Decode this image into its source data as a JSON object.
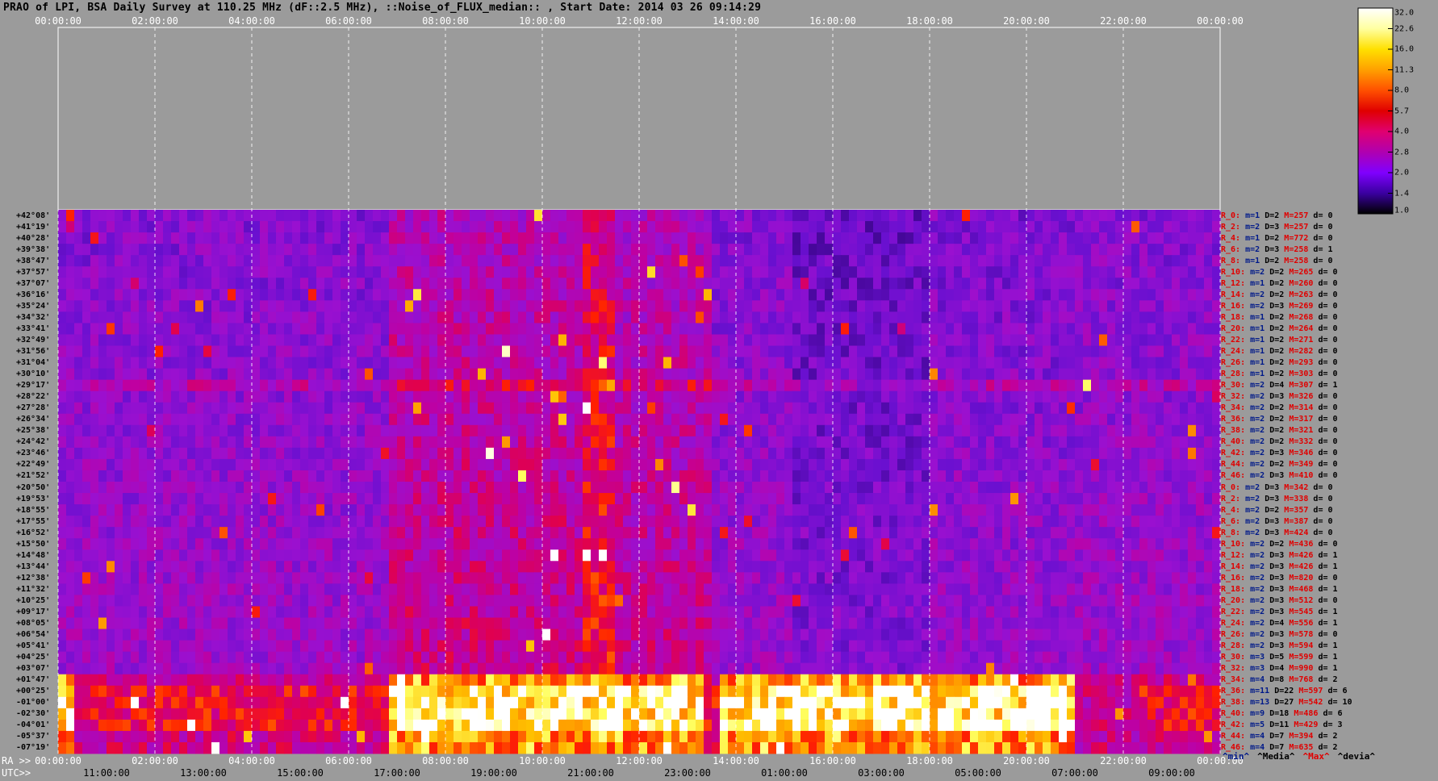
{
  "title": "PRAO of LPI, BSA Daily Survey at 110.25 MHz (dF::2.5 MHz), ::Noise_of_FLUX_median:: , Start Date: 2014 03 26 09:14:29",
  "chart_data": {
    "type": "heatmap",
    "title": "PRAO of LPI, BSA Daily Survey at 110.25 MHz (dF::2.5 MHz), ::Noise_of_FLUX_median:: , Start Date: 2014 03 26 09:14:29",
    "x_top_ticks": [
      "00:00:00",
      "02:00:00",
      "04:00:00",
      "06:00:00",
      "08:00:00",
      "10:00:00",
      "12:00:00",
      "14:00:00",
      "16:00:00",
      "18:00:00",
      "20:00:00",
      "22:00:00",
      "00:00:00"
    ],
    "x_bottom_ra_label": "RA >>",
    "x_bottom_ra_ticks": [
      "00:00:00",
      "02:00:00",
      "04:00:00",
      "06:00:00",
      "08:00:00",
      "10:00:00",
      "12:00:00",
      "14:00:00",
      "16:00:00",
      "18:00:00",
      "20:00:00",
      "22:00:00",
      "00:00:00"
    ],
    "x_bottom_utc_label": "UTC>>",
    "x_bottom_utc_ticks": [
      "11:00:00",
      "13:00:00",
      "15:00:00",
      "17:00:00",
      "19:00:00",
      "21:00:00",
      "23:00:00",
      "01:00:00",
      "03:00:00",
      "05:00:00",
      "07:00:00",
      "09:00:00"
    ],
    "declinations": [
      "+42°08'",
      "+41°19'",
      "+40°28'",
      "+39°38'",
      "+38°47'",
      "+37°57'",
      "+37°07'",
      "+36°16'",
      "+35°24'",
      "+34°32'",
      "+33°41'",
      "+32°49'",
      "+31°56'",
      "+31°04'",
      "+30°10'",
      "+29°17'",
      "+28°22'",
      "+27°28'",
      "+26°34'",
      "+25°38'",
      "+24°42'",
      "+23°46'",
      "+22°49'",
      "+21°52'",
      "+20°50'",
      "+19°53'",
      "+18°55'",
      "+17°55'",
      "+16°52'",
      "+15°50'",
      "+14°48'",
      "+13°44'",
      "+12°38'",
      "+11°32'",
      "+10°25'",
      "+09°17'",
      "+08°05'",
      "+06°54'",
      "+05°41'",
      "+04°25'",
      "+03°07'",
      "+01°47'",
      "+00°25'",
      "-01°00'",
      "-02°30'",
      "-04°01'",
      "-05°37'",
      "-07°19'"
    ],
    "colorbar_ticks": [
      "32.0",
      "22.6",
      "16.0",
      "11.3",
      "8.0",
      "5.7",
      "4.0",
      "2.8",
      "2.0",
      "1.4",
      "1.0"
    ],
    "colorbar_colors": [
      "#ffffff",
      "#ffffa0",
      "#ffe000",
      "#ffa000",
      "#ff5000",
      "#e00000",
      "#e00070",
      "#b000b0",
      "#8000ff",
      "#3a00a0",
      "#000000"
    ],
    "beams": [
      {
        "r": "R_0:",
        "m": "m=1",
        "d": "D=2",
        "M": "M=257",
        "dv": "d= 0"
      },
      {
        "r": "R_2:",
        "m": "m=2",
        "d": "D=3",
        "M": "M=257",
        "dv": "d= 0"
      },
      {
        "r": "R_4:",
        "m": "m=1",
        "d": "D=2",
        "M": "M=772",
        "dv": "d= 0"
      },
      {
        "r": "R_6:",
        "m": "m=2",
        "d": "D=3",
        "M": "M=258",
        "dv": "d= 1"
      },
      {
        "r": "R_8:",
        "m": "m=1",
        "d": "D=2",
        "M": "M=258",
        "dv": "d= 0"
      },
      {
        "r": "R_10:",
        "m": "m=2",
        "d": "D=2",
        "M": "M=265",
        "dv": "d= 0"
      },
      {
        "r": "R_12:",
        "m": "m=1",
        "d": "D=2",
        "M": "M=260",
        "dv": "d= 0"
      },
      {
        "r": "R_14:",
        "m": "m=2",
        "d": "D=2",
        "M": "M=263",
        "dv": "d= 0"
      },
      {
        "r": "R_16:",
        "m": "m=2",
        "d": "D=3",
        "M": "M=269",
        "dv": "d= 0"
      },
      {
        "r": "R_18:",
        "m": "m=1",
        "d": "D=2",
        "M": "M=268",
        "dv": "d= 0"
      },
      {
        "r": "R_20:",
        "m": "m=1",
        "d": "D=2",
        "M": "M=264",
        "dv": "d= 0"
      },
      {
        "r": "R_22:",
        "m": "m=1",
        "d": "D=2",
        "M": "M=271",
        "dv": "d= 0"
      },
      {
        "r": "R_24:",
        "m": "m=1",
        "d": "D=2",
        "M": "M=282",
        "dv": "d= 0"
      },
      {
        "r": "R_26:",
        "m": "m=1",
        "d": "D=2",
        "M": "M=293",
        "dv": "d= 0"
      },
      {
        "r": "R_28:",
        "m": "m=1",
        "d": "D=2",
        "M": "M=303",
        "dv": "d= 0"
      },
      {
        "r": "R_30:",
        "m": "m=2",
        "d": "D=4",
        "M": "M=307",
        "dv": "d= 1"
      },
      {
        "r": "R_32:",
        "m": "m=2",
        "d": "D=3",
        "M": "M=326",
        "dv": "d= 0"
      },
      {
        "r": "R_34:",
        "m": "m=2",
        "d": "D=2",
        "M": "M=314",
        "dv": "d= 0"
      },
      {
        "r": "R_36:",
        "m": "m=2",
        "d": "D=2",
        "M": "M=317",
        "dv": "d= 0"
      },
      {
        "r": "R_38:",
        "m": "m=2",
        "d": "D=2",
        "M": "M=321",
        "dv": "d= 0"
      },
      {
        "r": "R_40:",
        "m": "m=2",
        "d": "D=2",
        "M": "M=332",
        "dv": "d= 0"
      },
      {
        "r": "R_42:",
        "m": "m=2",
        "d": "D=3",
        "M": "M=346",
        "dv": "d= 0"
      },
      {
        "r": "R_44:",
        "m": "m=2",
        "d": "D=2",
        "M": "M=349",
        "dv": "d= 0"
      },
      {
        "r": "R_46:",
        "m": "m=2",
        "d": "D=3",
        "M": "M=410",
        "dv": "d= 0"
      },
      {
        "r": "R_0:",
        "m": "m=2",
        "d": "D=3",
        "M": "M=342",
        "dv": "d= 0"
      },
      {
        "r": "R_2:",
        "m": "m=2",
        "d": "D=3",
        "M": "M=338",
        "dv": "d= 0"
      },
      {
        "r": "R_4:",
        "m": "m=2",
        "d": "D=2",
        "M": "M=357",
        "dv": "d= 0"
      },
      {
        "r": "R_6:",
        "m": "m=2",
        "d": "D=3",
        "M": "M=387",
        "dv": "d= 0"
      },
      {
        "r": "R_8:",
        "m": "m=2",
        "d": "D=3",
        "M": "M=424",
        "dv": "d= 0"
      },
      {
        "r": "R_10:",
        "m": "m=2",
        "d": "D=2",
        "M": "M=436",
        "dv": "d= 0"
      },
      {
        "r": "R_12:",
        "m": "m=2",
        "d": "D=3",
        "M": "M=426",
        "dv": "d= 1"
      },
      {
        "r": "R_14:",
        "m": "m=2",
        "d": "D=3",
        "M": "M=426",
        "dv": "d= 1"
      },
      {
        "r": "R_16:",
        "m": "m=2",
        "d": "D=3",
        "M": "M=820",
        "dv": "d= 0"
      },
      {
        "r": "R_18:",
        "m": "m=2",
        "d": "D=3",
        "M": "M=468",
        "dv": "d= 1"
      },
      {
        "r": "R_20:",
        "m": "m=2",
        "d": "D=3",
        "M": "M=512",
        "dv": "d= 0"
      },
      {
        "r": "R_22:",
        "m": "m=2",
        "d": "D=3",
        "M": "M=545",
        "dv": "d= 1"
      },
      {
        "r": "R_24:",
        "m": "m=2",
        "d": "D=4",
        "M": "M=556",
        "dv": "d= 1"
      },
      {
        "r": "R_26:",
        "m": "m=2",
        "d": "D=3",
        "M": "M=578",
        "dv": "d= 0"
      },
      {
        "r": "R_28:",
        "m": "m=2",
        "d": "D=3",
        "M": "M=594",
        "dv": "d= 1"
      },
      {
        "r": "R_30:",
        "m": "m=3",
        "d": "D=5",
        "M": "M=599",
        "dv": "d= 1"
      },
      {
        "r": "R_32:",
        "m": "m=3",
        "d": "D=4",
        "M": "M=990",
        "dv": "d= 1"
      },
      {
        "r": "R_34:",
        "m": "m=4",
        "d": "D=8",
        "M": "M=768",
        "dv": "d= 2"
      },
      {
        "r": "R_36:",
        "m": "m=11",
        "d": "D=22",
        "M": "M=597",
        "dv": "d= 6"
      },
      {
        "r": "R_38:",
        "m": "m=13",
        "d": "D=27",
        "M": "M=542",
        "dv": "d= 10"
      },
      {
        "r": "R_40:",
        "m": "m=9",
        "d": "D=18",
        "M": "M=486",
        "dv": "d= 6"
      },
      {
        "r": "R_42:",
        "m": "m=5",
        "d": "D=11",
        "M": "M=429",
        "dv": "d= 3"
      },
      {
        "r": "R_44:",
        "m": "m=4",
        "d": "D=7",
        "M": "M=394",
        "dv": "d= 2"
      },
      {
        "r": "R_46:",
        "m": "m=4",
        "d": "D=7",
        "M": "M=635",
        "dv": "d= 2"
      }
    ],
    "legend": [
      "^min^",
      "^Media^",
      "^Max^",
      "^devia^"
    ],
    "legend_colors": [
      "#001a8a",
      "#000000",
      "#e00000",
      "#000000"
    ]
  }
}
